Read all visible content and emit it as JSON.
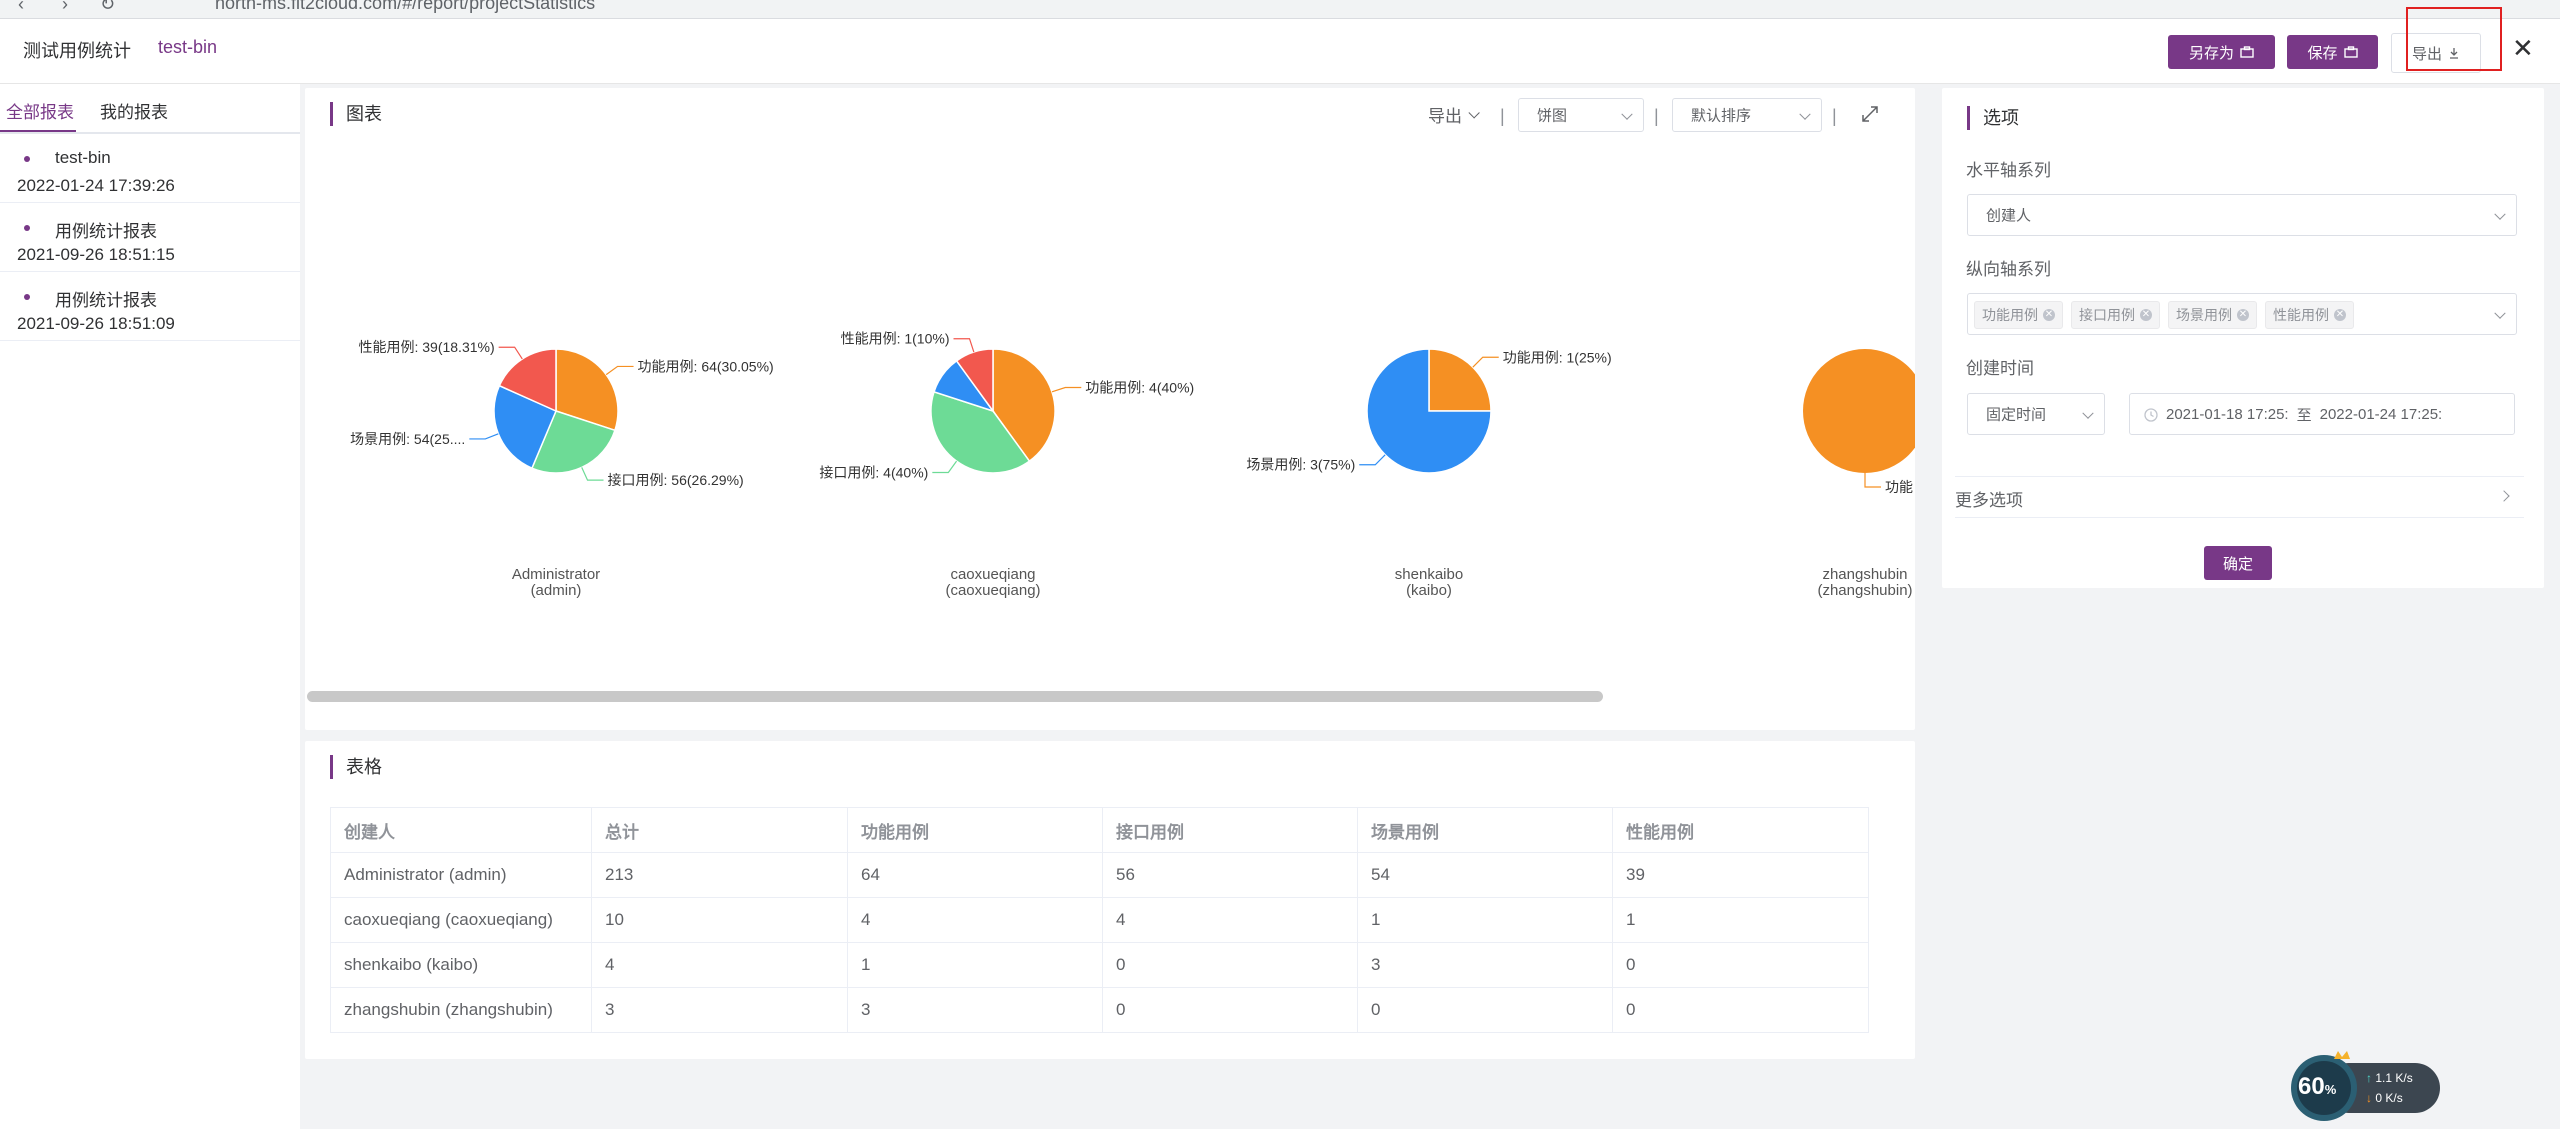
{
  "browser": {
    "url": "north-ms.fit2cloud.com/#/report/projectStatistics"
  },
  "header": {
    "page_title": "测试用例统计",
    "report_name": "test-bin",
    "save_as_label": "另存为",
    "save_label": "保存",
    "export_label": "导出"
  },
  "sidebar": {
    "tabs": [
      {
        "label": "全部报表"
      },
      {
        "label": "我的报表"
      }
    ],
    "reports": [
      {
        "name": "test-bin",
        "time": "2022-01-24 17:39:26"
      },
      {
        "name": "用例统计报表",
        "time": "2021-09-26 18:51:15"
      },
      {
        "name": "用例统计报表",
        "time": "2021-09-26 18:51:09"
      }
    ]
  },
  "chart_panel": {
    "title": "图表",
    "export_label": "导出",
    "chart_type_value": "饼图",
    "sort_value": "默认排序"
  },
  "chart_data": {
    "type": "pie",
    "colors": {
      "功能用例": "#f59023",
      "接口用例": "#6ddb96",
      "场景用例": "#2f8ef4",
      "性能用例": "#f2584e"
    },
    "pies": [
      {
        "name": "Administrator",
        "sub": "(admin)",
        "slices": [
          {
            "label": "功能用例",
            "value": 64,
            "text": "功能用例: 64(30.05%)"
          },
          {
            "label": "接口用例",
            "value": 56,
            "text": "接口用例: 56(26.29%)"
          },
          {
            "label": "场景用例",
            "value": 54,
            "text": "场景用例: 54(25...."
          },
          {
            "label": "性能用例",
            "value": 39,
            "text": "性能用例: 39(18.31%)"
          }
        ]
      },
      {
        "name": "caoxueqiang",
        "sub": "(caoxueqiang)",
        "slices": [
          {
            "label": "功能用例",
            "value": 4,
            "text": "功能用例: 4(40%)"
          },
          {
            "label": "接口用例",
            "value": 4,
            "text": "接口用例: 4(40%)"
          },
          {
            "label": "场景用例",
            "value": 1,
            "text": ""
          },
          {
            "label": "性能用例",
            "value": 1,
            "text": "性能用例: 1(10%)"
          }
        ]
      },
      {
        "name": "shenkaibo",
        "sub": "(kaibo)",
        "slices": [
          {
            "label": "功能用例",
            "value": 1,
            "text": "功能用例: 1(25%)"
          },
          {
            "label": "接口用例",
            "value": 0,
            "text": ""
          },
          {
            "label": "场景用例",
            "value": 3,
            "text": "场景用例: 3(75%)"
          },
          {
            "label": "性能用例",
            "value": 0,
            "text": ""
          }
        ]
      },
      {
        "name": "zhangshubin",
        "sub": "(zhangshubin)",
        "slices": [
          {
            "label": "功能用例",
            "value": 3,
            "text": "功能"
          },
          {
            "label": "接口用例",
            "value": 0,
            "text": ""
          },
          {
            "label": "场景用例",
            "value": 0,
            "text": ""
          },
          {
            "label": "性能用例",
            "value": 0,
            "text": ""
          }
        ]
      }
    ]
  },
  "table_panel": {
    "title": "表格",
    "columns": [
      "创建人",
      "总计",
      "功能用例",
      "接口用例",
      "场景用例",
      "性能用例"
    ],
    "rows": [
      [
        "Administrator (admin)",
        "213",
        "64",
        "56",
        "54",
        "39"
      ],
      [
        "caoxueqiang (caoxueqiang)",
        "10",
        "4",
        "4",
        "1",
        "1"
      ],
      [
        "shenkaibo (kaibo)",
        "4",
        "1",
        "0",
        "3",
        "0"
      ],
      [
        "zhangshubin (zhangshubin)",
        "3",
        "3",
        "0",
        "0",
        "0"
      ]
    ]
  },
  "options": {
    "title": "选项",
    "x_axis_label": "水平轴系列",
    "x_axis_value": "创建人",
    "y_axis_label": "纵向轴系列",
    "y_axis_tags": [
      "功能用例",
      "接口用例",
      "场景用例",
      "性能用例"
    ],
    "time_label": "创建时间",
    "time_mode": "固定时间",
    "date_start": "2021-01-18 17:25:",
    "date_sep": "至",
    "date_end": "2022-01-24 17:25:",
    "more_label": "更多选项",
    "confirm_label": "确定"
  },
  "net_widget": {
    "percent": "60",
    "percent_unit": "%",
    "up": "1.1",
    "down": "0",
    "unit": "K/s"
  }
}
